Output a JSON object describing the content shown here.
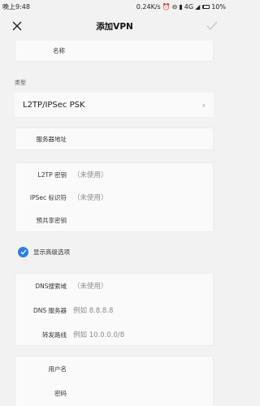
{
  "status_bar": {
    "time": "晚上9:48",
    "net_speed": "0.24K/s",
    "network": "4G",
    "battery_pct": "10%",
    "battery_level": 0.1
  },
  "header": {
    "title": "添加VPN"
  },
  "fields": {
    "name_label": "名称",
    "type_section_label": "类型",
    "type_value": "L2TP/IPSec PSK",
    "server_label": "服务器地址",
    "l2tp_secret_label": "L2TP 密钥",
    "l2tp_secret_value": "（未使用）",
    "ipsec_id_label": "IPSec 标识符",
    "ipsec_id_value": "（未使用）",
    "psk_label": "预共享密钥",
    "advanced_label": "显示高级选项",
    "dns_domain_label": "DNS搜索域",
    "dns_domain_value": "（未使用）",
    "dns_server_label": "DNS 服务器",
    "dns_server_placeholder": "例如 8.8.8.8",
    "route_label": "转发路线",
    "route_placeholder": "例如 10.0.0.0/8",
    "username_label": "用户名",
    "password_label": "密码"
  },
  "colors": {
    "accent": "#2b7de9",
    "background": "#f2f2f2"
  }
}
